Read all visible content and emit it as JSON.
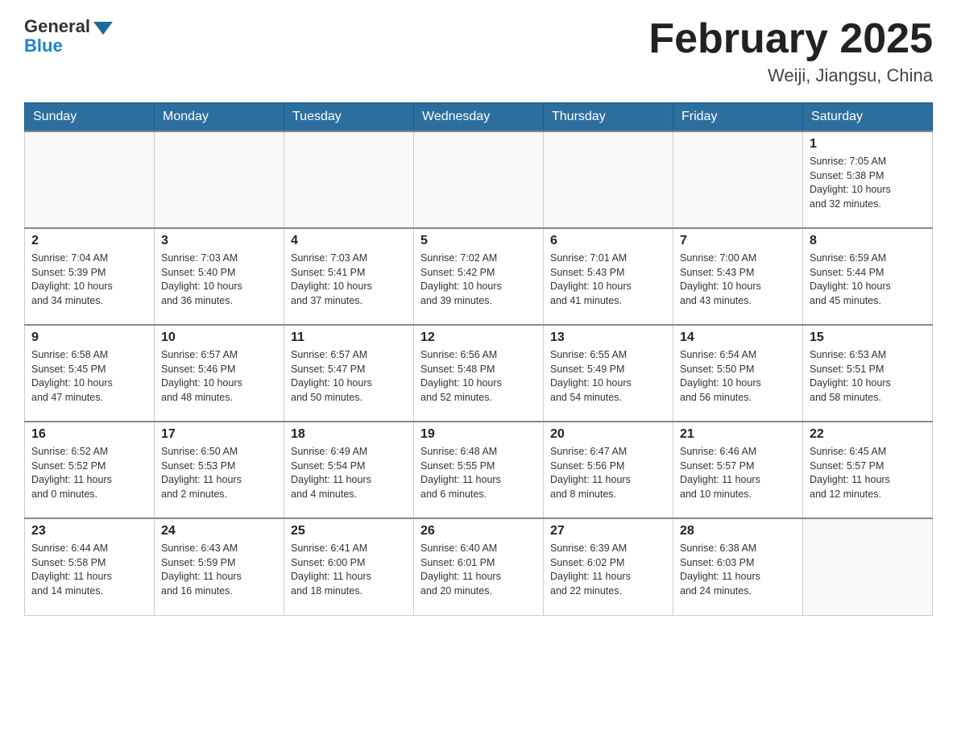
{
  "logo": {
    "general": "General",
    "blue": "Blue"
  },
  "title": "February 2025",
  "location": "Weiji, Jiangsu, China",
  "weekdays": [
    "Sunday",
    "Monday",
    "Tuesday",
    "Wednesday",
    "Thursday",
    "Friday",
    "Saturday"
  ],
  "weeks": [
    [
      {
        "day": "",
        "info": ""
      },
      {
        "day": "",
        "info": ""
      },
      {
        "day": "",
        "info": ""
      },
      {
        "day": "",
        "info": ""
      },
      {
        "day": "",
        "info": ""
      },
      {
        "day": "",
        "info": ""
      },
      {
        "day": "1",
        "info": "Sunrise: 7:05 AM\nSunset: 5:38 PM\nDaylight: 10 hours\nand 32 minutes."
      }
    ],
    [
      {
        "day": "2",
        "info": "Sunrise: 7:04 AM\nSunset: 5:39 PM\nDaylight: 10 hours\nand 34 minutes."
      },
      {
        "day": "3",
        "info": "Sunrise: 7:03 AM\nSunset: 5:40 PM\nDaylight: 10 hours\nand 36 minutes."
      },
      {
        "day": "4",
        "info": "Sunrise: 7:03 AM\nSunset: 5:41 PM\nDaylight: 10 hours\nand 37 minutes."
      },
      {
        "day": "5",
        "info": "Sunrise: 7:02 AM\nSunset: 5:42 PM\nDaylight: 10 hours\nand 39 minutes."
      },
      {
        "day": "6",
        "info": "Sunrise: 7:01 AM\nSunset: 5:43 PM\nDaylight: 10 hours\nand 41 minutes."
      },
      {
        "day": "7",
        "info": "Sunrise: 7:00 AM\nSunset: 5:43 PM\nDaylight: 10 hours\nand 43 minutes."
      },
      {
        "day": "8",
        "info": "Sunrise: 6:59 AM\nSunset: 5:44 PM\nDaylight: 10 hours\nand 45 minutes."
      }
    ],
    [
      {
        "day": "9",
        "info": "Sunrise: 6:58 AM\nSunset: 5:45 PM\nDaylight: 10 hours\nand 47 minutes."
      },
      {
        "day": "10",
        "info": "Sunrise: 6:57 AM\nSunset: 5:46 PM\nDaylight: 10 hours\nand 48 minutes."
      },
      {
        "day": "11",
        "info": "Sunrise: 6:57 AM\nSunset: 5:47 PM\nDaylight: 10 hours\nand 50 minutes."
      },
      {
        "day": "12",
        "info": "Sunrise: 6:56 AM\nSunset: 5:48 PM\nDaylight: 10 hours\nand 52 minutes."
      },
      {
        "day": "13",
        "info": "Sunrise: 6:55 AM\nSunset: 5:49 PM\nDaylight: 10 hours\nand 54 minutes."
      },
      {
        "day": "14",
        "info": "Sunrise: 6:54 AM\nSunset: 5:50 PM\nDaylight: 10 hours\nand 56 minutes."
      },
      {
        "day": "15",
        "info": "Sunrise: 6:53 AM\nSunset: 5:51 PM\nDaylight: 10 hours\nand 58 minutes."
      }
    ],
    [
      {
        "day": "16",
        "info": "Sunrise: 6:52 AM\nSunset: 5:52 PM\nDaylight: 11 hours\nand 0 minutes."
      },
      {
        "day": "17",
        "info": "Sunrise: 6:50 AM\nSunset: 5:53 PM\nDaylight: 11 hours\nand 2 minutes."
      },
      {
        "day": "18",
        "info": "Sunrise: 6:49 AM\nSunset: 5:54 PM\nDaylight: 11 hours\nand 4 minutes."
      },
      {
        "day": "19",
        "info": "Sunrise: 6:48 AM\nSunset: 5:55 PM\nDaylight: 11 hours\nand 6 minutes."
      },
      {
        "day": "20",
        "info": "Sunrise: 6:47 AM\nSunset: 5:56 PM\nDaylight: 11 hours\nand 8 minutes."
      },
      {
        "day": "21",
        "info": "Sunrise: 6:46 AM\nSunset: 5:57 PM\nDaylight: 11 hours\nand 10 minutes."
      },
      {
        "day": "22",
        "info": "Sunrise: 6:45 AM\nSunset: 5:57 PM\nDaylight: 11 hours\nand 12 minutes."
      }
    ],
    [
      {
        "day": "23",
        "info": "Sunrise: 6:44 AM\nSunset: 5:58 PM\nDaylight: 11 hours\nand 14 minutes."
      },
      {
        "day": "24",
        "info": "Sunrise: 6:43 AM\nSunset: 5:59 PM\nDaylight: 11 hours\nand 16 minutes."
      },
      {
        "day": "25",
        "info": "Sunrise: 6:41 AM\nSunset: 6:00 PM\nDaylight: 11 hours\nand 18 minutes."
      },
      {
        "day": "26",
        "info": "Sunrise: 6:40 AM\nSunset: 6:01 PM\nDaylight: 11 hours\nand 20 minutes."
      },
      {
        "day": "27",
        "info": "Sunrise: 6:39 AM\nSunset: 6:02 PM\nDaylight: 11 hours\nand 22 minutes."
      },
      {
        "day": "28",
        "info": "Sunrise: 6:38 AM\nSunset: 6:03 PM\nDaylight: 11 hours\nand 24 minutes."
      },
      {
        "day": "",
        "info": ""
      }
    ]
  ]
}
